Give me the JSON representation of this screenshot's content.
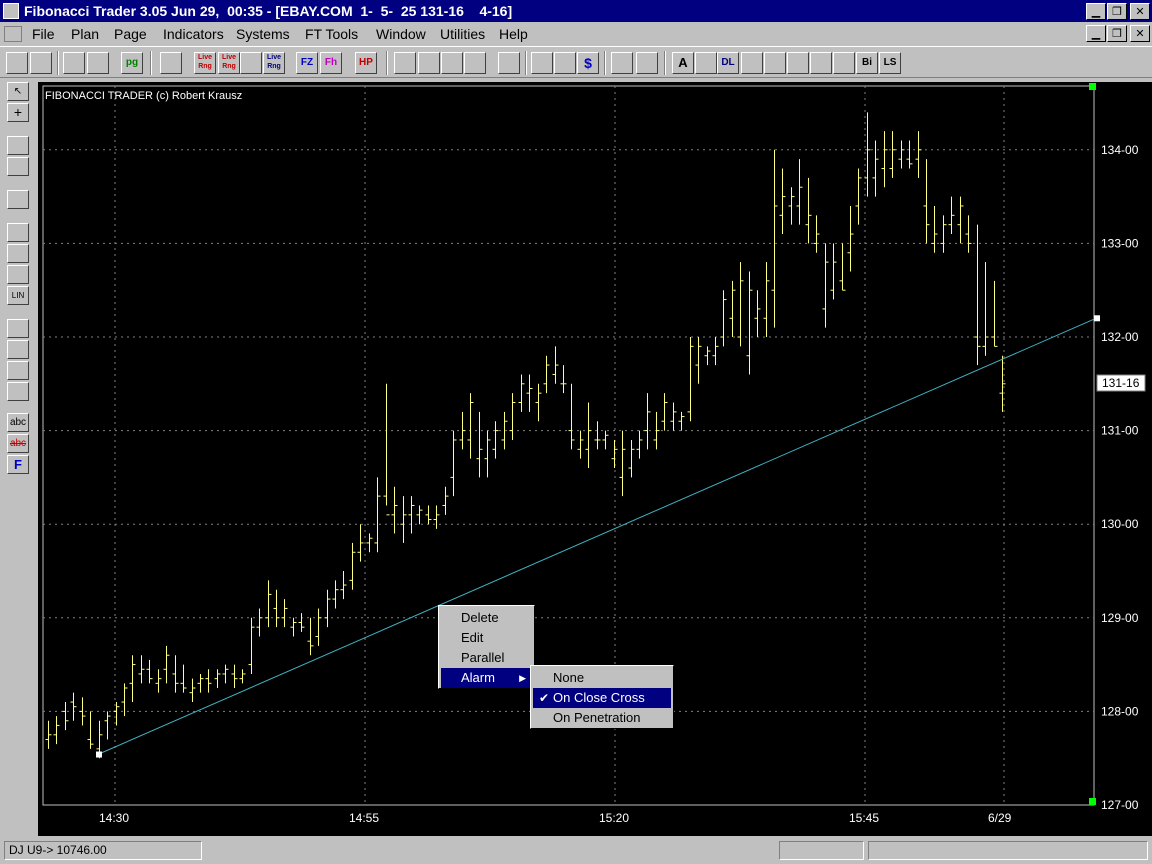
{
  "window": {
    "title": "Fibonacci Trader 3.05 Jun 29,  00:35 - [EBAY.COM  1-  5-  25 131-16    4-16]",
    "minimize": "▁",
    "restore": "❐",
    "close": "✕"
  },
  "menu": {
    "items": [
      "File",
      "Plan",
      "Page",
      "Indicators",
      "Systems",
      "FT Tools",
      "Window",
      "Utilities",
      "Help"
    ]
  },
  "toolbar": {
    "buttons": [
      "",
      "",
      "",
      "",
      "pg",
      "",
      "Live Rng",
      "Live Rng",
      "FZ",
      "Fh",
      "HP",
      "",
      "",
      "",
      "",
      "",
      "",
      "",
      "$",
      "",
      "",
      "A",
      "",
      "DL",
      "",
      "",
      "",
      "",
      "",
      "Bi",
      "LS"
    ]
  },
  "lefttools": {
    "buttons": [
      "↖",
      "+",
      "",
      "",
      "",
      "",
      "",
      "",
      "LIN",
      "",
      "",
      "",
      "",
      "abc",
      "abc",
      "F"
    ]
  },
  "chart": {
    "watermark": "FIBONACCI TRADER (c) Robert Krausz",
    "last_price_label": "131-16"
  },
  "chart_data": {
    "type": "bar",
    "symbol": "EBAY.COM",
    "y_ticks": [
      127,
      128,
      129,
      130,
      131,
      132,
      133,
      134
    ],
    "y_tick_labels": [
      "127-00",
      "128-00",
      "129-00",
      "130-00",
      "131-00",
      "132-00",
      "133-00",
      "134-00"
    ],
    "ylim": [
      127,
      134.7
    ],
    "x_tick_labels": [
      "14:30",
      "14:55",
      "15:20",
      "15:45",
      "6/29"
    ],
    "grid": true,
    "trendline": {
      "start_price": 127.55,
      "end_price": 132.2
    },
    "bars": [
      [
        127.9,
        127.6,
        127.7,
        127.75
      ],
      [
        127.95,
        127.65,
        127.75,
        127.85
      ],
      [
        128.1,
        127.8,
        128.0,
        127.9
      ],
      [
        128.2,
        127.9,
        128.1,
        128.05
      ],
      [
        128.15,
        127.85,
        128.0,
        127.95
      ],
      [
        128.0,
        127.6,
        127.7,
        127.65
      ],
      [
        127.9,
        127.5,
        127.6,
        127.75
      ],
      [
        128.0,
        127.7,
        127.9,
        127.95
      ],
      [
        128.1,
        127.85,
        128.0,
        128.05
      ],
      [
        128.3,
        127.95,
        128.1,
        128.25
      ],
      [
        128.6,
        128.1,
        128.3,
        128.5
      ],
      [
        128.6,
        128.3,
        128.4,
        128.45
      ],
      [
        128.55,
        128.3,
        128.45,
        128.35
      ],
      [
        128.45,
        128.2,
        128.3,
        128.35
      ],
      [
        128.7,
        128.3,
        128.45,
        128.6
      ],
      [
        128.6,
        128.2,
        128.4,
        128.3
      ],
      [
        128.5,
        128.2,
        128.3,
        128.25
      ],
      [
        128.35,
        128.1,
        128.2,
        128.25
      ],
      [
        128.4,
        128.2,
        128.3,
        128.35
      ],
      [
        128.45,
        128.2,
        128.35,
        128.3
      ],
      [
        128.45,
        128.25,
        128.35,
        128.4
      ],
      [
        128.5,
        128.3,
        128.4,
        128.45
      ],
      [
        128.5,
        128.25,
        128.4,
        128.35
      ],
      [
        128.45,
        128.3,
        128.35,
        128.4
      ],
      [
        129.0,
        128.4,
        128.5,
        128.9
      ],
      [
        129.1,
        128.8,
        128.9,
        129.0
      ],
      [
        129.4,
        128.9,
        129.0,
        129.25
      ],
      [
        129.3,
        128.9,
        129.1,
        129.0
      ],
      [
        129.2,
        128.9,
        129.0,
        129.1
      ],
      [
        129.0,
        128.8,
        128.9,
        128.95
      ],
      [
        129.05,
        128.85,
        128.95,
        128.9
      ],
      [
        129.0,
        128.6,
        128.75,
        128.7
      ],
      [
        129.1,
        128.7,
        128.8,
        129.0
      ],
      [
        129.3,
        128.9,
        129.0,
        129.2
      ],
      [
        129.4,
        129.1,
        129.2,
        129.3
      ],
      [
        129.5,
        129.2,
        129.3,
        129.35
      ],
      [
        129.8,
        129.3,
        129.4,
        129.7
      ],
      [
        130.0,
        129.6,
        129.7,
        129.8
      ],
      [
        129.9,
        129.7,
        129.8,
        129.85
      ],
      [
        130.5,
        129.7,
        129.8,
        130.3
      ],
      [
        131.5,
        130.2,
        130.3,
        130.1
      ],
      [
        130.4,
        129.9,
        130.1,
        130.2
      ],
      [
        130.3,
        129.8,
        130.0,
        130.1
      ],
      [
        130.3,
        129.9,
        130.1,
        130.2
      ],
      [
        130.2,
        130.0,
        130.1,
        130.15
      ],
      [
        130.2,
        130.0,
        130.1,
        130.05
      ],
      [
        130.2,
        129.95,
        130.05,
        130.1
      ],
      [
        130.4,
        130.1,
        130.2,
        130.3
      ],
      [
        131.0,
        130.3,
        130.5,
        130.9
      ],
      [
        131.2,
        130.8,
        130.9,
        131.0
      ],
      [
        131.4,
        130.7,
        130.9,
        131.3
      ],
      [
        131.2,
        130.5,
        130.7,
        130.8
      ],
      [
        131.0,
        130.5,
        130.7,
        130.9
      ],
      [
        131.1,
        130.7,
        130.8,
        131.0
      ],
      [
        131.2,
        130.8,
        130.9,
        131.1
      ],
      [
        131.4,
        130.9,
        131.0,
        131.3
      ],
      [
        131.6,
        131.2,
        131.3,
        131.5
      ],
      [
        131.6,
        131.2,
        131.4,
        131.45
      ],
      [
        131.5,
        131.1,
        131.3,
        131.4
      ],
      [
        131.8,
        131.4,
        131.5,
        131.7
      ],
      [
        131.9,
        131.5,
        131.6,
        131.7
      ],
      [
        131.7,
        131.4,
        131.5,
        131.5
      ],
      [
        131.5,
        130.8,
        131.0,
        130.9
      ],
      [
        131.0,
        130.7,
        130.8,
        130.9
      ],
      [
        131.3,
        130.6,
        130.8,
        131.0
      ],
      [
        131.1,
        130.8,
        130.9,
        130.9
      ],
      [
        131.0,
        130.8,
        130.9,
        130.95
      ],
      [
        130.9,
        130.6,
        130.7,
        130.8
      ],
      [
        131.0,
        130.3,
        130.5,
        130.8
      ],
      [
        130.9,
        130.5,
        130.6,
        130.8
      ],
      [
        131.0,
        130.7,
        130.8,
        130.9
      ],
      [
        131.4,
        130.8,
        131.0,
        131.2
      ],
      [
        131.2,
        130.8,
        130.9,
        131.0
      ],
      [
        131.4,
        131.0,
        131.1,
        131.3
      ],
      [
        131.3,
        131.0,
        131.1,
        131.2
      ],
      [
        131.2,
        131.0,
        131.1,
        131.15
      ],
      [
        132.0,
        131.1,
        131.2,
        131.9
      ],
      [
        132.0,
        131.5,
        131.7,
        131.9
      ],
      [
        131.9,
        131.7,
        131.8,
        131.85
      ],
      [
        132.0,
        131.7,
        131.8,
        131.9
      ],
      [
        132.5,
        131.9,
        132.0,
        132.4
      ],
      [
        132.6,
        132.0,
        132.2,
        132.5
      ],
      [
        132.8,
        131.9,
        132.0,
        132.6
      ],
      [
        132.7,
        131.6,
        131.8,
        132.5
      ],
      [
        132.5,
        132.0,
        132.2,
        132.3
      ],
      [
        132.8,
        132.0,
        132.2,
        132.6
      ],
      [
        134.0,
        132.1,
        132.5,
        133.4
      ],
      [
        133.8,
        133.1,
        133.3,
        133.5
      ],
      [
        133.6,
        133.2,
        133.4,
        133.5
      ],
      [
        133.9,
        133.2,
        133.4,
        133.6
      ],
      [
        133.7,
        133.0,
        133.2,
        133.3
      ],
      [
        133.3,
        132.9,
        133.0,
        133.1
      ],
      [
        133.0,
        132.1,
        132.3,
        132.8
      ],
      [
        133.0,
        132.4,
        132.5,
        132.8
      ],
      [
        133.0,
        132.5,
        132.6,
        132.5
      ],
      [
        133.4,
        132.7,
        132.9,
        133.1
      ],
      [
        133.8,
        133.2,
        133.4,
        133.7
      ],
      [
        134.4,
        133.5,
        133.7,
        134.0
      ],
      [
        134.1,
        133.5,
        133.7,
        133.9
      ],
      [
        134.2,
        133.6,
        133.8,
        134.0
      ],
      [
        134.2,
        133.7,
        133.8,
        134.0
      ],
      [
        134.1,
        133.8,
        133.9,
        134.0
      ],
      [
        134.1,
        133.8,
        133.9,
        133.85
      ],
      [
        134.2,
        133.7,
        133.9,
        134.0
      ],
      [
        133.9,
        133.0,
        133.4,
        133.2
      ],
      [
        133.4,
        132.9,
        133.0,
        133.1
      ],
      [
        133.3,
        132.9,
        133.0,
        133.2
      ],
      [
        133.5,
        133.1,
        133.2,
        133.3
      ],
      [
        133.5,
        133.0,
        133.2,
        133.4
      ],
      [
        133.3,
        132.9,
        133.1,
        133.0
      ],
      [
        133.2,
        131.7,
        132.0,
        131.9
      ],
      [
        132.8,
        131.8,
        131.9,
        132.0
      ],
      [
        132.6,
        131.9,
        132.0,
        131.9
      ],
      [
        131.8,
        131.2,
        131.4,
        131.5
      ]
    ],
    "context_menu": {
      "items": [
        "Delete",
        "Edit",
        "Parallel",
        "Alarm"
      ],
      "selected": "Alarm",
      "submenu": {
        "items": [
          "None",
          "On Close Cross",
          "On Penetration"
        ],
        "checked": "On Close Cross"
      }
    }
  },
  "status": {
    "dj": "DJ U9-> 10746.00",
    "middle": "",
    "right": ""
  }
}
